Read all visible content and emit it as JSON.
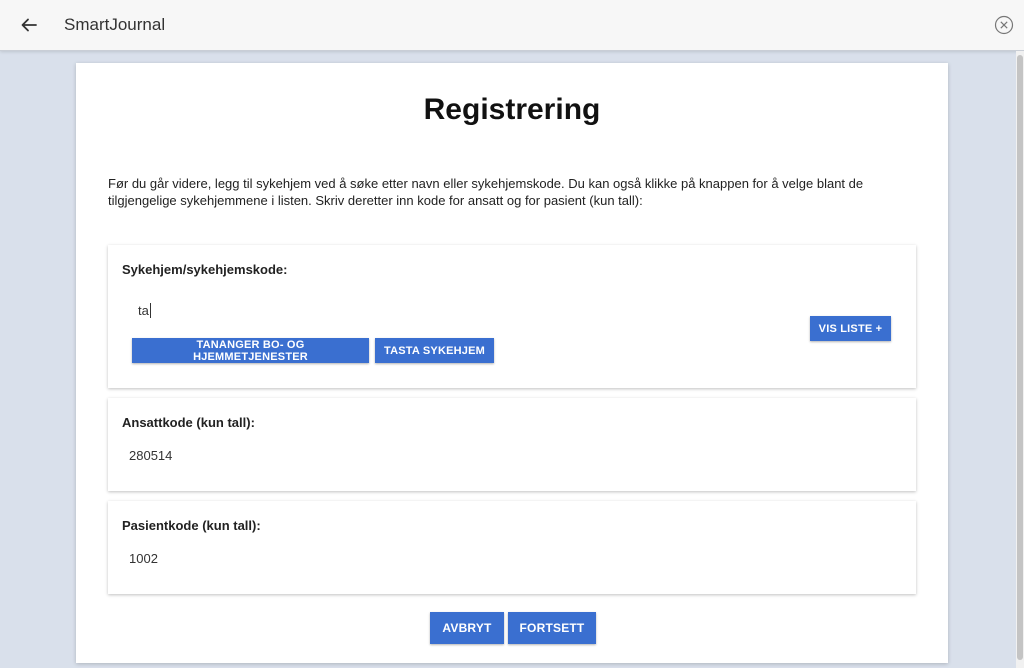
{
  "header": {
    "title": "SmartJournal",
    "back_icon": "arrow-left-icon",
    "close_icon": "close-circle-icon"
  },
  "page": {
    "title": "Registrering",
    "intro": "Før du går videre, legg til sykehjem ved å søke etter navn eller sykehjemskode. Du kan også klikke på knappen for å velge blant de tilgjengelige sykehjemmene i listen. Skriv deretter inn kode for ansatt og for pasient (kun tall):"
  },
  "nursing_home": {
    "label": "Sykehjem/sykehjemskode:",
    "input_value": "ta",
    "suggestions": [
      "TANANGER BO- OG HJEMMETJENESTER",
      "TASTA SYKEHJEM"
    ],
    "show_list_label": "VIS LISTE +"
  },
  "employee": {
    "label": "Ansattkode (kun tall):",
    "value": "280514"
  },
  "patient": {
    "label": "Pasientkode (kun tall):",
    "value": "1002"
  },
  "actions": {
    "cancel_label": "AVBRYT",
    "continue_label": "FORTSETT"
  },
  "colors": {
    "accent": "#3a6fd0",
    "background": "#d9e0eb"
  }
}
